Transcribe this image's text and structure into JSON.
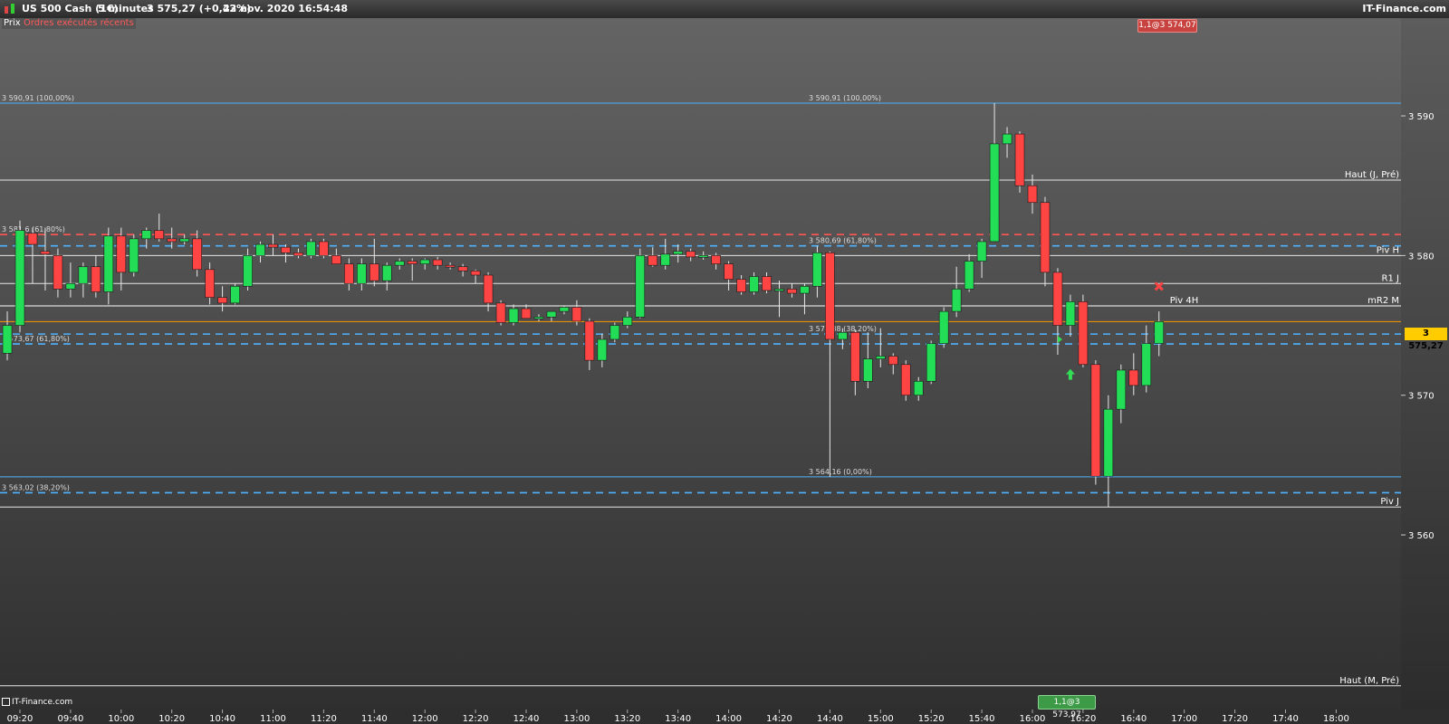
{
  "header": {
    "instrument": "US 500 Cash (1€)",
    "timeframe": "5 minutes",
    "quote": "3 575,27 (+0,42%)",
    "datetime": "23 nov. 2020 16:54:48",
    "brand": "IT-Finance.com"
  },
  "subheader": {
    "price_tab": "Prix",
    "orders_tab": "Ordres exécutés récents"
  },
  "footer": {
    "brand": "IT-Finance.com"
  },
  "colors": {
    "up": "#22dd55",
    "down": "#ff4444",
    "grid": "#ffffff",
    "fib": "#4fb3ff",
    "price": "#ff9900",
    "badge_red": "#c8433f",
    "badge_green": "#3d9a47"
  },
  "orders": {
    "top_label": "1,1@3 574,07",
    "bottom_label": "1,1@3 573,97"
  },
  "current_price": "3 575,27",
  "chart_data": {
    "type": "candlestick",
    "y_ticks": [
      3560,
      3570,
      3580,
      3590
    ],
    "y_tick_labels": [
      "3 560",
      "3 570",
      "3 580",
      "3 590"
    ],
    "x_tick_labels": [
      "09:20",
      "09:40",
      "10:00",
      "10:20",
      "10:40",
      "11:00",
      "11:20",
      "11:40",
      "12:00",
      "12:20",
      "12:40",
      "13:00",
      "13:20",
      "13:40",
      "14:00",
      "14:20",
      "14:40",
      "15:00",
      "15:20",
      "15:40",
      "16:00",
      "16:20",
      "16:40",
      "17:00",
      "17:20",
      "17:40",
      "18:00"
    ],
    "x_tick_minutes": [
      560,
      580,
      600,
      620,
      640,
      660,
      680,
      700,
      720,
      740,
      760,
      780,
      800,
      820,
      840,
      860,
      880,
      900,
      920,
      940,
      960,
      980,
      1000,
      1020,
      1040,
      1060,
      1080
    ],
    "ylim": [
      3547.5,
      3597.0
    ],
    "candles": [
      {
        "t": 555,
        "o": 3573.0,
        "h": 3576.0,
        "l": 3572.5,
        "c": 3575.0
      },
      {
        "t": 560,
        "o": 3575.0,
        "h": 3582.5,
        "l": 3574.5,
        "c": 3581.8
      },
      {
        "t": 565,
        "o": 3581.6,
        "h": 3582.0,
        "l": 3578.0,
        "c": 3580.8
      },
      {
        "t": 570,
        "o": 3580.3,
        "h": 3582.0,
        "l": 3577.5,
        "c": 3580.1
      },
      {
        "t": 575,
        "o": 3580.0,
        "h": 3580.5,
        "l": 3577.0,
        "c": 3577.6
      },
      {
        "t": 580,
        "o": 3577.6,
        "h": 3579.5,
        "l": 3577.0,
        "c": 3578.0
      },
      {
        "t": 585,
        "o": 3578.0,
        "h": 3579.5,
        "l": 3577.0,
        "c": 3579.2
      },
      {
        "t": 590,
        "o": 3579.2,
        "h": 3580.0,
        "l": 3577.0,
        "c": 3577.4
      },
      {
        "t": 595,
        "o": 3577.4,
        "h": 3582.0,
        "l": 3576.5,
        "c": 3581.4
      },
      {
        "t": 600,
        "o": 3581.4,
        "h": 3582.0,
        "l": 3577.5,
        "c": 3578.8
      },
      {
        "t": 605,
        "o": 3578.8,
        "h": 3581.5,
        "l": 3578.5,
        "c": 3581.2
      },
      {
        "t": 610,
        "o": 3581.2,
        "h": 3582.0,
        "l": 3580.5,
        "c": 3581.8
      },
      {
        "t": 615,
        "o": 3581.8,
        "h": 3583.0,
        "l": 3581.0,
        "c": 3581.2
      },
      {
        "t": 620,
        "o": 3581.2,
        "h": 3582.0,
        "l": 3580.5,
        "c": 3581.0
      },
      {
        "t": 625,
        "o": 3581.0,
        "h": 3581.5,
        "l": 3580.8,
        "c": 3581.2
      },
      {
        "t": 630,
        "o": 3581.2,
        "h": 3581.8,
        "l": 3578.5,
        "c": 3579.0
      },
      {
        "t": 635,
        "o": 3579.0,
        "h": 3579.5,
        "l": 3576.5,
        "c": 3577.0
      },
      {
        "t": 640,
        "o": 3577.0,
        "h": 3577.8,
        "l": 3576.0,
        "c": 3576.6
      },
      {
        "t": 645,
        "o": 3576.6,
        "h": 3578.0,
        "l": 3576.5,
        "c": 3577.8
      },
      {
        "t": 650,
        "o": 3577.8,
        "h": 3580.5,
        "l": 3577.5,
        "c": 3580.0
      },
      {
        "t": 655,
        "o": 3580.0,
        "h": 3581.0,
        "l": 3579.5,
        "c": 3580.8
      },
      {
        "t": 660,
        "o": 3580.8,
        "h": 3581.5,
        "l": 3580.0,
        "c": 3580.6
      },
      {
        "t": 665,
        "o": 3580.6,
        "h": 3580.8,
        "l": 3579.5,
        "c": 3580.2
      },
      {
        "t": 670,
        "o": 3580.2,
        "h": 3580.5,
        "l": 3579.8,
        "c": 3580.0
      },
      {
        "t": 675,
        "o": 3580.0,
        "h": 3581.2,
        "l": 3579.8,
        "c": 3581.0
      },
      {
        "t": 680,
        "o": 3581.0,
        "h": 3581.2,
        "l": 3579.8,
        "c": 3580.0
      },
      {
        "t": 685,
        "o": 3580.0,
        "h": 3580.5,
        "l": 3579.5,
        "c": 3579.4
      },
      {
        "t": 690,
        "o": 3579.4,
        "h": 3579.8,
        "l": 3577.5,
        "c": 3578.0
      },
      {
        "t": 695,
        "o": 3578.0,
        "h": 3579.8,
        "l": 3577.5,
        "c": 3579.4
      },
      {
        "t": 700,
        "o": 3579.4,
        "h": 3581.2,
        "l": 3577.8,
        "c": 3578.2
      },
      {
        "t": 705,
        "o": 3578.2,
        "h": 3579.5,
        "l": 3577.5,
        "c": 3579.3
      },
      {
        "t": 710,
        "o": 3579.3,
        "h": 3579.8,
        "l": 3579.0,
        "c": 3579.6
      },
      {
        "t": 715,
        "o": 3579.6,
        "h": 3579.8,
        "l": 3578.2,
        "c": 3579.4
      },
      {
        "t": 720,
        "o": 3579.4,
        "h": 3579.8,
        "l": 3579.0,
        "c": 3579.7
      },
      {
        "t": 725,
        "o": 3579.7,
        "h": 3579.9,
        "l": 3579.0,
        "c": 3579.3
      },
      {
        "t": 730,
        "o": 3579.3,
        "h": 3579.5,
        "l": 3579.0,
        "c": 3579.2
      },
      {
        "t": 735,
        "o": 3579.2,
        "h": 3579.4,
        "l": 3578.5,
        "c": 3578.9
      },
      {
        "t": 740,
        "o": 3578.9,
        "h": 3579.0,
        "l": 3578.0,
        "c": 3578.6
      },
      {
        "t": 745,
        "o": 3578.6,
        "h": 3578.8,
        "l": 3576.0,
        "c": 3576.6
      },
      {
        "t": 750,
        "o": 3576.6,
        "h": 3576.8,
        "l": 3575.0,
        "c": 3575.2
      },
      {
        "t": 755,
        "o": 3575.2,
        "h": 3576.5,
        "l": 3575.0,
        "c": 3576.2
      },
      {
        "t": 760,
        "o": 3576.2,
        "h": 3576.5,
        "l": 3575.5,
        "c": 3575.5
      },
      {
        "t": 765,
        "o": 3575.5,
        "h": 3575.8,
        "l": 3575.3,
        "c": 3575.6
      },
      {
        "t": 770,
        "o": 3575.6,
        "h": 3576.0,
        "l": 3575.3,
        "c": 3576.0
      },
      {
        "t": 775,
        "o": 3576.0,
        "h": 3576.4,
        "l": 3575.8,
        "c": 3576.3
      },
      {
        "t": 780,
        "o": 3576.3,
        "h": 3576.8,
        "l": 3575.0,
        "c": 3575.3
      },
      {
        "t": 785,
        "o": 3575.3,
        "h": 3575.5,
        "l": 3571.8,
        "c": 3572.5
      },
      {
        "t": 790,
        "o": 3572.5,
        "h": 3574.4,
        "l": 3572.0,
        "c": 3574.0
      },
      {
        "t": 795,
        "o": 3574.0,
        "h": 3575.2,
        "l": 3573.8,
        "c": 3575.0
      },
      {
        "t": 800,
        "o": 3575.0,
        "h": 3576.0,
        "l": 3574.8,
        "c": 3575.6
      },
      {
        "t": 805,
        "o": 3575.6,
        "h": 3580.5,
        "l": 3575.5,
        "c": 3580.0
      },
      {
        "t": 810,
        "o": 3580.0,
        "h": 3580.6,
        "l": 3579.2,
        "c": 3579.3
      },
      {
        "t": 815,
        "o": 3579.3,
        "h": 3581.2,
        "l": 3579.0,
        "c": 3580.1
      },
      {
        "t": 820,
        "o": 3580.1,
        "h": 3580.8,
        "l": 3579.5,
        "c": 3580.3
      },
      {
        "t": 825,
        "o": 3580.3,
        "h": 3580.5,
        "l": 3579.6,
        "c": 3579.9
      },
      {
        "t": 830,
        "o": 3579.9,
        "h": 3580.3,
        "l": 3579.7,
        "c": 3580.0
      },
      {
        "t": 835,
        "o": 3580.0,
        "h": 3580.2,
        "l": 3579.0,
        "c": 3579.4
      },
      {
        "t": 840,
        "o": 3579.4,
        "h": 3579.6,
        "l": 3577.5,
        "c": 3578.3
      },
      {
        "t": 845,
        "o": 3578.3,
        "h": 3578.6,
        "l": 3577.2,
        "c": 3577.4
      },
      {
        "t": 850,
        "o": 3577.4,
        "h": 3578.8,
        "l": 3577.2,
        "c": 3578.5
      },
      {
        "t": 855,
        "o": 3578.5,
        "h": 3578.8,
        "l": 3577.3,
        "c": 3577.5
      },
      {
        "t": 860,
        "o": 3577.5,
        "h": 3578.2,
        "l": 3575.6,
        "c": 3577.6
      },
      {
        "t": 865,
        "o": 3577.6,
        "h": 3578.0,
        "l": 3577.0,
        "c": 3577.3
      },
      {
        "t": 870,
        "o": 3577.3,
        "h": 3578.0,
        "l": 3575.8,
        "c": 3577.8
      },
      {
        "t": 875,
        "o": 3577.8,
        "h": 3580.7,
        "l": 3577.0,
        "c": 3580.2
      },
      {
        "t": 880,
        "o": 3580.2,
        "h": 3580.3,
        "l": 3564.16,
        "c": 3574.0
      },
      {
        "t": 885,
        "o": 3574.0,
        "h": 3574.8,
        "l": 3573.3,
        "c": 3574.5
      },
      {
        "t": 890,
        "o": 3574.5,
        "h": 3574.7,
        "l": 3570.0,
        "c": 3571.0
      },
      {
        "t": 895,
        "o": 3571.0,
        "h": 3574.5,
        "l": 3570.5,
        "c": 3572.6
      },
      {
        "t": 900,
        "o": 3572.6,
        "h": 3574.8,
        "l": 3572.0,
        "c": 3572.8
      },
      {
        "t": 905,
        "o": 3572.8,
        "h": 3573.0,
        "l": 3571.5,
        "c": 3572.2
      },
      {
        "t": 910,
        "o": 3572.2,
        "h": 3572.5,
        "l": 3569.6,
        "c": 3570.0
      },
      {
        "t": 915,
        "o": 3570.0,
        "h": 3571.3,
        "l": 3569.6,
        "c": 3571.0
      },
      {
        "t": 920,
        "o": 3571.0,
        "h": 3573.9,
        "l": 3570.8,
        "c": 3573.7
      },
      {
        "t": 925,
        "o": 3573.7,
        "h": 3576.3,
        "l": 3573.4,
        "c": 3576.0
      },
      {
        "t": 930,
        "o": 3576.0,
        "h": 3579.2,
        "l": 3575.6,
        "c": 3577.6
      },
      {
        "t": 935,
        "o": 3577.6,
        "h": 3580.1,
        "l": 3577.4,
        "c": 3579.6
      },
      {
        "t": 940,
        "o": 3579.6,
        "h": 3581.2,
        "l": 3578.4,
        "c": 3581.0
      },
      {
        "t": 945,
        "o": 3581.0,
        "h": 3590.91,
        "l": 3582.5,
        "c": 3588.0
      },
      {
        "t": 950,
        "o": 3588.0,
        "h": 3589.2,
        "l": 3587.0,
        "c": 3588.7
      },
      {
        "t": 955,
        "o": 3588.7,
        "h": 3588.9,
        "l": 3584.5,
        "c": 3585.0
      },
      {
        "t": 960,
        "o": 3585.0,
        "h": 3585.8,
        "l": 3583.0,
        "c": 3583.8
      },
      {
        "t": 965,
        "o": 3583.8,
        "h": 3584.2,
        "l": 3577.8,
        "c": 3578.8
      },
      {
        "t": 970,
        "o": 3578.8,
        "h": 3579.1,
        "l": 3572.9,
        "c": 3575.0
      },
      {
        "t": 975,
        "o": 3575.0,
        "h": 3577.2,
        "l": 3574.2,
        "c": 3576.7
      },
      {
        "t": 980,
        "o": 3576.7,
        "h": 3577.2,
        "l": 3572.0,
        "c": 3572.2
      },
      {
        "t": 985,
        "o": 3572.2,
        "h": 3572.5,
        "l": 3563.6,
        "c": 3564.2
      },
      {
        "t": 990,
        "o": 3564.2,
        "h": 3570.0,
        "l": 3562.0,
        "c": 3569.0
      },
      {
        "t": 995,
        "o": 3569.0,
        "h": 3572.2,
        "l": 3568.0,
        "c": 3571.8
      },
      {
        "t": 1000,
        "o": 3571.8,
        "h": 3573.0,
        "l": 3570.0,
        "c": 3570.7
      },
      {
        "t": 1005,
        "o": 3570.7,
        "h": 3575.0,
        "l": 3570.2,
        "c": 3573.7
      },
      {
        "t": 1010,
        "o": 3573.7,
        "h": 3576.0,
        "l": 3572.8,
        "c": 3575.27
      }
    ],
    "horizontal_lines": [
      {
        "y": 3590.91,
        "style": "solid",
        "color": "#4fb3ff",
        "label": "3 590,91 (100,00%)",
        "label2": "3 590,91 (100,00%)"
      },
      {
        "y": 3585.4,
        "style": "solid",
        "color": "#e6e6e6",
        "right_label": "Haut (J, Pré)"
      },
      {
        "y": 3581.5,
        "style": "dashed",
        "color": "#ff5555",
        "label": "3 581,6 (61,80%)"
      },
      {
        "y": 3580.69,
        "style": "dashed",
        "color": "#4fb3ff",
        "label2": "3 580,69 (61,80%)"
      },
      {
        "y": 3580.0,
        "style": "solid",
        "color": "#e6e6e6",
        "right_label": "Piv H"
      },
      {
        "y": 3578.0,
        "style": "solid",
        "color": "#e6e6e6",
        "right_label": "R1 J"
      },
      {
        "y": 3576.4,
        "style": "solid",
        "color": "#ffffff",
        "right_label": "mR2 M"
      },
      {
        "y": 3575.27,
        "style": "solid",
        "color": "#ff9900"
      },
      {
        "y": 3574.38,
        "style": "dashed",
        "color": "#4fb3ff",
        "label2": "3 574,38 (38,20%)"
      },
      {
        "y": 3573.67,
        "style": "dashed",
        "color": "#4fb3ff",
        "label": "3 573,67 (61,80%)"
      },
      {
        "y": 3564.16,
        "style": "solid",
        "color": "#4fb3ff",
        "label2": "3 564,16 (0,00%)"
      },
      {
        "y": 3563.02,
        "style": "dashed",
        "color": "#4fb3ff",
        "label": "3 563,02 (38,20%)"
      },
      {
        "y": 3562.0,
        "style": "solid",
        "color": "#e6e6e6",
        "right_label": "Piv J"
      },
      {
        "y": 3549.2,
        "style": "solid",
        "color": "#e6e6e6",
        "right_label": "Haut (M, Pré)"
      }
    ],
    "piv4h": {
      "label": "Piv 4H",
      "t": 1015,
      "y": 3576.4
    }
  }
}
